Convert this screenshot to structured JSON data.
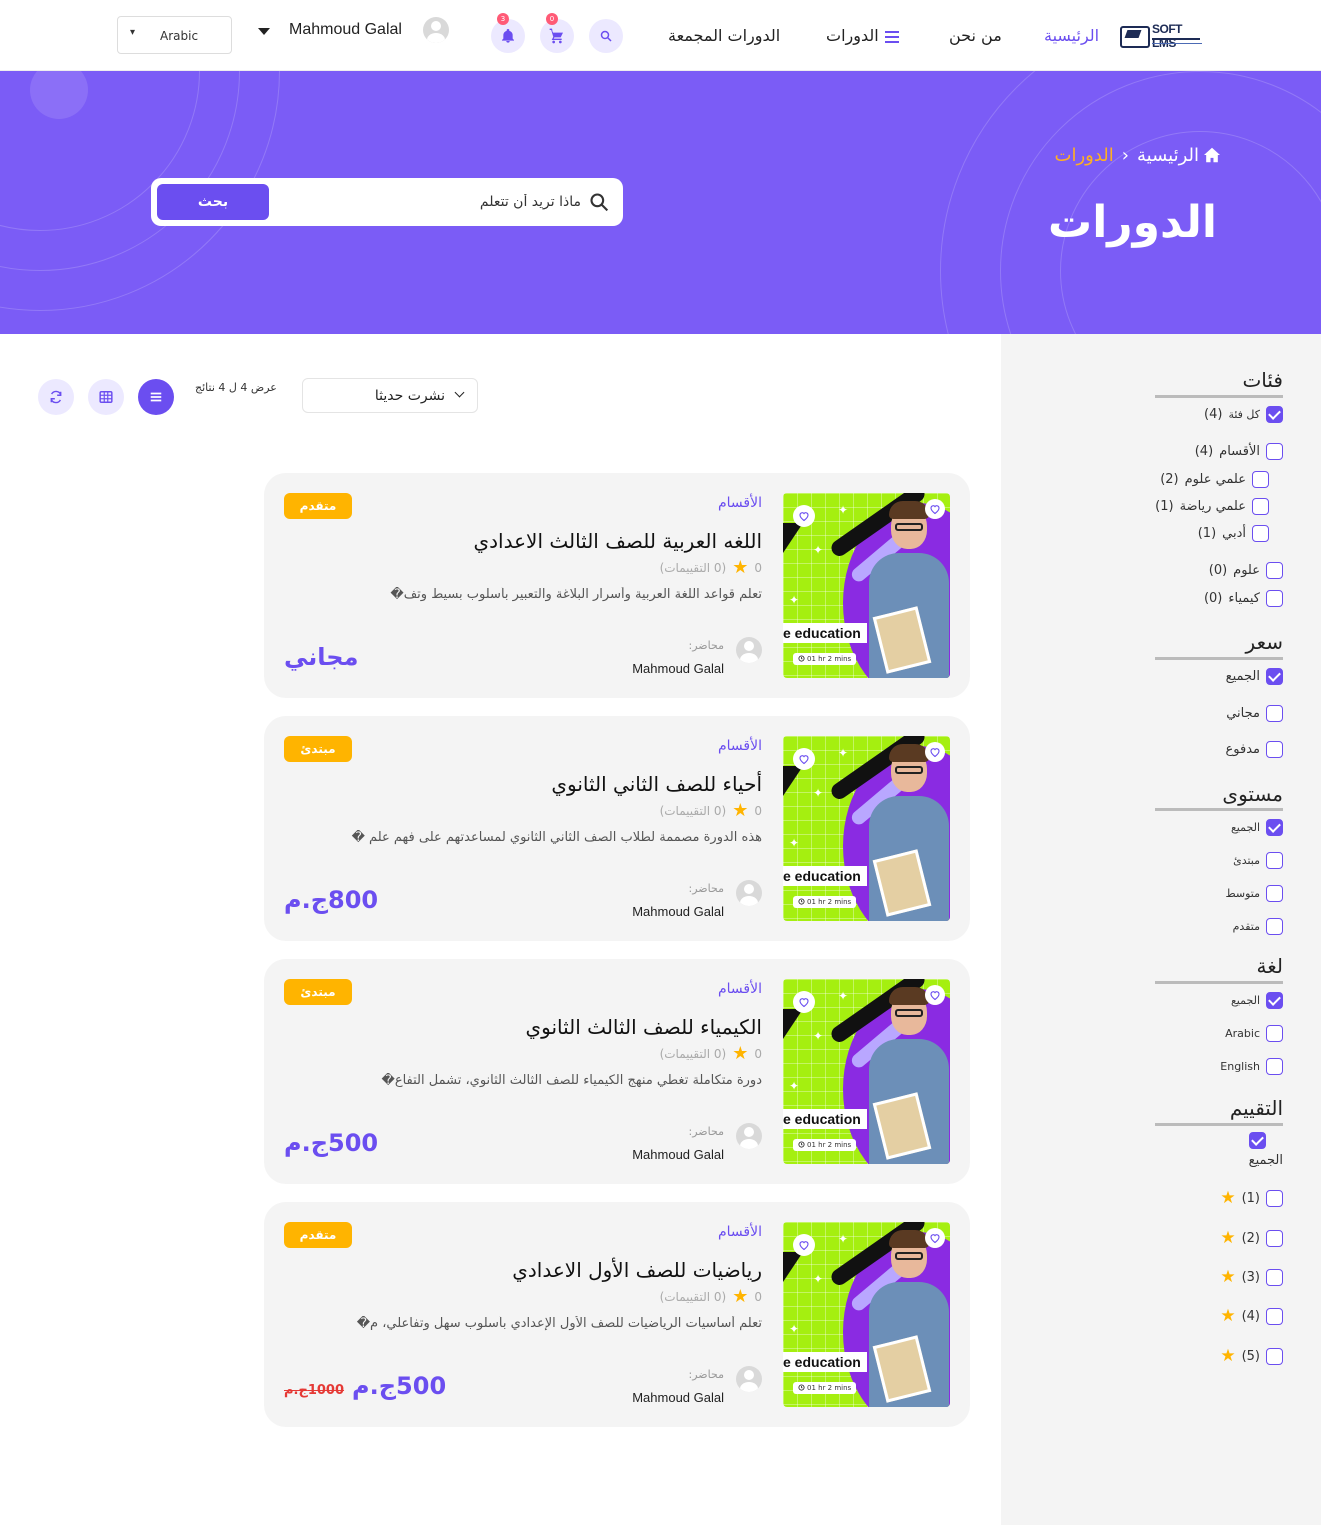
{
  "header": {
    "language": "Arabic",
    "user_name": "Mahmoud Galal",
    "notifications_count": "3",
    "cart_count": "0",
    "nav": {
      "home": "الرئيسية",
      "about": "من نحن",
      "courses": "الدورات",
      "bundles": "الدورات المجمعة"
    },
    "logo_text": "SOFT LMS"
  },
  "hero": {
    "breadcrumb_home": "الرئيسية",
    "breadcrumb_current": "الدورات",
    "title": "الدورات",
    "search_placeholder": "ماذا تريد أن تتعلم",
    "search_button": "بحث"
  },
  "toolbar": {
    "sort_value": "نشرت حديثا",
    "results_text": "عرض 4 ل 4 نتائج"
  },
  "filters": {
    "categories": {
      "title": "فئات",
      "items": [
        {
          "label": "كل فئة",
          "count": "(4)",
          "checked": true
        },
        {
          "label": "الأقسام",
          "count": "(4)",
          "checked": false
        },
        {
          "label": "علمي علوم",
          "count": "(2)",
          "checked": false
        },
        {
          "label": "علمي رياضة",
          "count": "(1)",
          "checked": false
        },
        {
          "label": "أدبي",
          "count": "(1)",
          "checked": false
        },
        {
          "label": "علوم",
          "count": "(0)",
          "checked": false
        },
        {
          "label": "كيمياء",
          "count": "(0)",
          "checked": false
        }
      ]
    },
    "price": {
      "title": "سعر",
      "items": [
        {
          "label": "الجميع",
          "checked": true
        },
        {
          "label": "مجاني",
          "checked": false
        },
        {
          "label": "مدفوع",
          "checked": false
        }
      ]
    },
    "level": {
      "title": "مستوى",
      "items": [
        {
          "label": "الجميع",
          "checked": true
        },
        {
          "label": "مبتدئ",
          "checked": false
        },
        {
          "label": "متوسط",
          "checked": false
        },
        {
          "label": "متقدم",
          "checked": false
        }
      ]
    },
    "language": {
      "title": "لغة",
      "items": [
        {
          "label": "الجميع",
          "checked": true
        },
        {
          "label": "Arabic",
          "checked": false
        },
        {
          "label": "English",
          "checked": false
        }
      ]
    },
    "rating": {
      "title": "التقييم",
      "all_label": "الجميع",
      "items": [
        {
          "label": "(1)",
          "checked": false
        },
        {
          "label": "(2)",
          "checked": false
        },
        {
          "label": "(3)",
          "checked": false
        },
        {
          "label": "(4)",
          "checked": false
        },
        {
          "label": "(5)",
          "checked": false
        }
      ]
    }
  },
  "course_common": {
    "category": "الأقسام",
    "lecturer_label": "محاضر:",
    "edu_label": "e education",
    "duration": "01 hr 2 mins"
  },
  "courses": [
    {
      "title": "اللغه العربية للصف الثالث الاعدادي",
      "rating_value": "0",
      "rating_text": "(0 التقييمات)",
      "description": "تعلم قواعد اللغة العربية وأسرار البلاغة والتعبير بأسلوب بسيط وتف�",
      "lecturer": "Mahmoud Galal",
      "level": "متقدم",
      "price": "مجاني",
      "old_price": ""
    },
    {
      "title": "أحياء للصف الثاني الثانوي",
      "rating_value": "0",
      "rating_text": "(0 التقييمات)",
      "description": "هذه الدورة مصممة لطلاب الصف الثاني الثانوي لمساعدتهم على فهم علم �",
      "lecturer": "Mahmoud Galal",
      "level": "مبتدئ",
      "price": "800ج.م",
      "old_price": ""
    },
    {
      "title": "الكيمياء للصف الثالث الثانوي",
      "rating_value": "0",
      "rating_text": "(0 التقييمات)",
      "description": "دورة متكاملة تغطي منهج الكيمياء للصف الثالث الثانوي، تشمل التفاع�",
      "lecturer": "Mahmoud Galal",
      "level": "مبتدئ",
      "price": "500ج.م",
      "old_price": ""
    },
    {
      "title": "رياضيات للصف الأول الاعدادي",
      "rating_value": "0",
      "rating_text": "(0 التقييمات)",
      "description": "تعلم أساسيات الرياضيات للصف الأول الإعدادي بأسلوب سهل وتفاعلي، م�",
      "lecturer": "Mahmoud Galal",
      "level": "متقدم",
      "price": "500ج.م",
      "old_price": "1000ج.م"
    }
  ],
  "colors": {
    "primary": "#6b4ef0",
    "hero_bg": "#7b5cf6",
    "accent": "#ffb400",
    "breadcrumb_current": "#ffb020",
    "thumb_green": "#a5ef10",
    "old_price": "#e53935"
  }
}
